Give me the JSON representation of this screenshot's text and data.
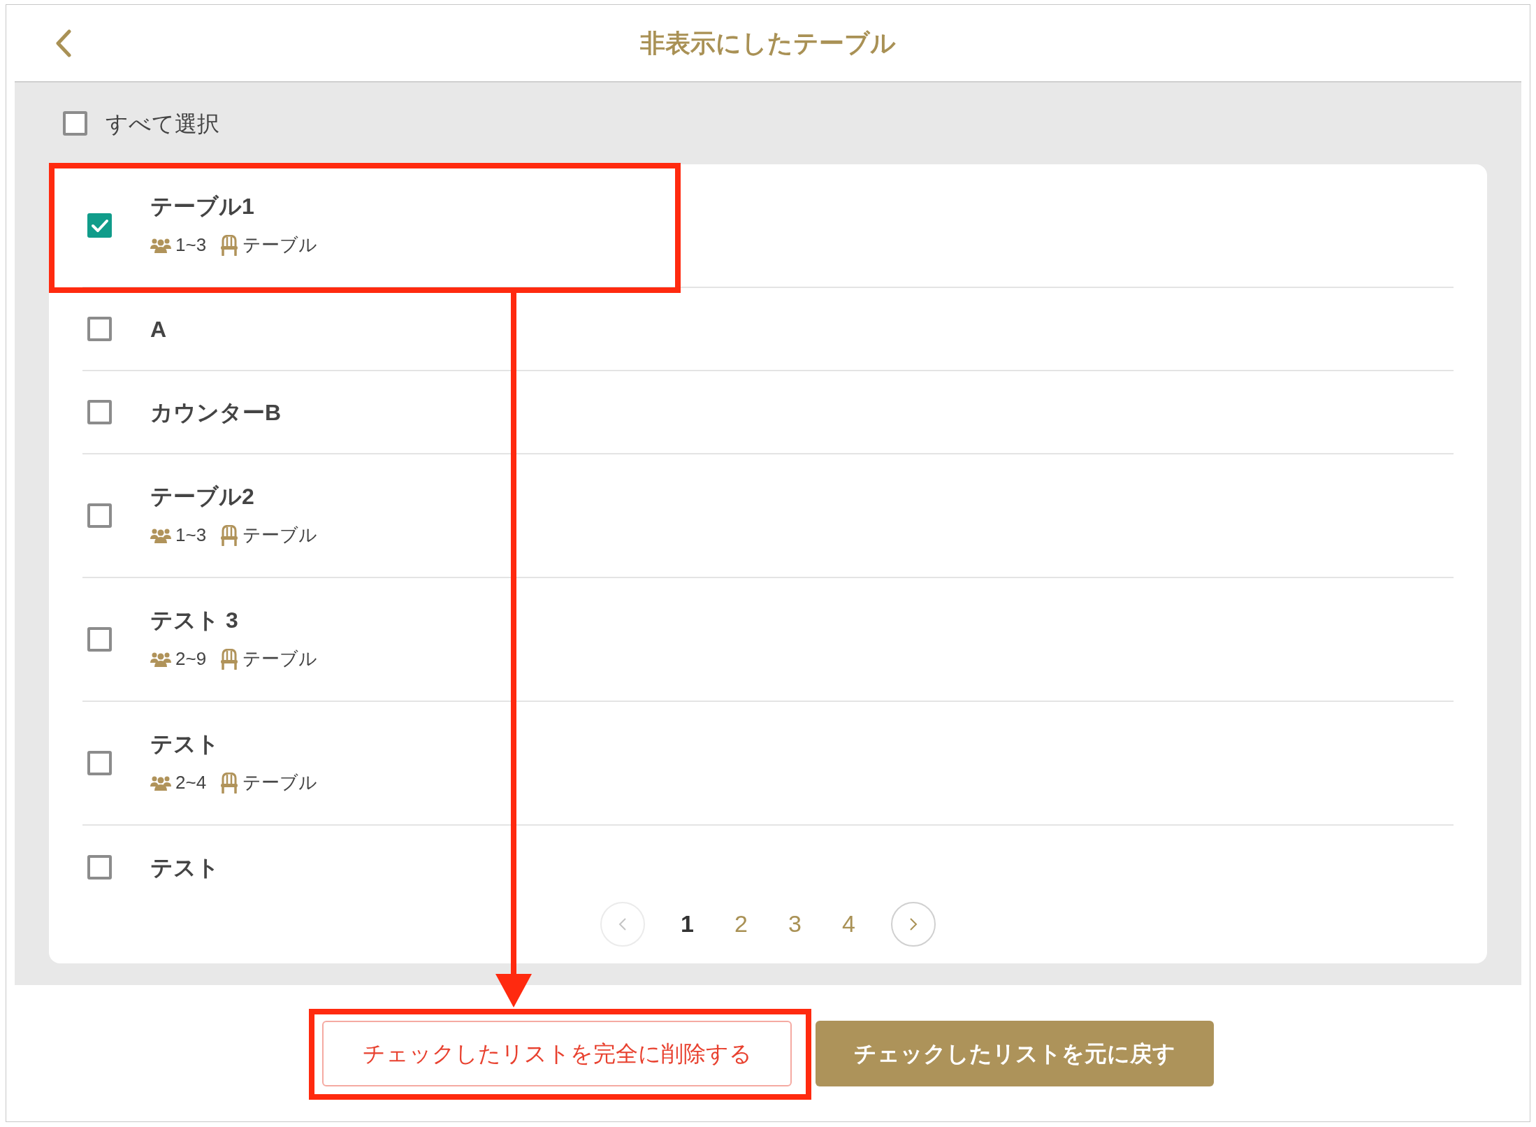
{
  "header": {
    "title": "非表示にしたテーブル"
  },
  "select_all": {
    "label": "すべて選択",
    "checked": false
  },
  "tables": [
    {
      "name": "テーブル1",
      "checked": true,
      "capacity": "1~3",
      "type": "テーブル"
    },
    {
      "name": "A",
      "checked": false
    },
    {
      "name": "カウンターB",
      "checked": false
    },
    {
      "name": "テーブル2",
      "checked": false,
      "capacity": "1~3",
      "type": "テーブル"
    },
    {
      "name": "テスト 3",
      "checked": false,
      "capacity": "2~9",
      "type": "テーブル"
    },
    {
      "name": "テスト",
      "checked": false,
      "capacity": "2~4",
      "type": "テーブル"
    },
    {
      "name": "テスト",
      "checked": false
    }
  ],
  "pagination": {
    "prev_disabled": true,
    "next_disabled": false,
    "pages": [
      {
        "label": "1",
        "selected": true
      },
      {
        "label": "2",
        "selected": false
      },
      {
        "label": "3",
        "selected": false
      },
      {
        "label": "4",
        "selected": false
      }
    ]
  },
  "buttons": [
    {
      "kind": "danger",
      "label": "チェックしたリストを完全に削除する"
    },
    {
      "kind": "primary",
      "label": "チェックしたリストを元に戻す"
    }
  ]
}
